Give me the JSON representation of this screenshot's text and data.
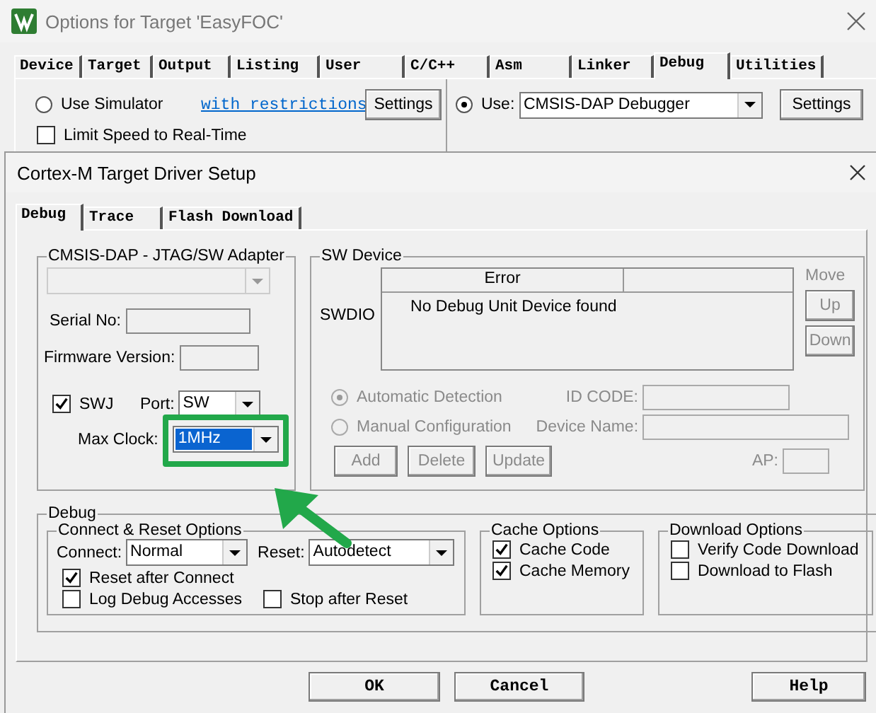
{
  "window": {
    "title": "Options for Target 'EasyFOC'"
  },
  "tabs": [
    {
      "label": "Device",
      "selected": false
    },
    {
      "label": "Target",
      "selected": false
    },
    {
      "label": "Output",
      "selected": false
    },
    {
      "label": "Listing",
      "selected": false
    },
    {
      "label": "User",
      "selected": false
    },
    {
      "label": "C/C++",
      "selected": false
    },
    {
      "label": "Asm",
      "selected": false
    },
    {
      "label": "Linker",
      "selected": false
    },
    {
      "label": "Debug",
      "selected": true
    },
    {
      "label": "Utilities",
      "selected": false
    }
  ],
  "simulator": {
    "label": "Use Simulator",
    "selected": false,
    "link": "with restrictions",
    "settings_button": "Settings",
    "limit_speed": {
      "label": "Limit Speed to Real-Time",
      "checked": false
    }
  },
  "debugger": {
    "label": "Use:",
    "selected": true,
    "value": "CMSIS-DAP Debugger",
    "settings_button": "Settings"
  },
  "dialog": {
    "title": "Cortex-M Target Driver Setup",
    "tabs": [
      {
        "label": "Debug",
        "selected": true
      },
      {
        "label": "Trace",
        "selected": false
      },
      {
        "label": "Flash Download",
        "selected": false
      }
    ],
    "adapter": {
      "title": "CMSIS-DAP - JTAG/SW Adapter",
      "serial_label": "Serial No:",
      "firmware_label": "Firmware Version:",
      "swj": {
        "label": "SWJ",
        "checked": true
      },
      "port_label": "Port:",
      "port": "SW",
      "max_clock_label": "Max Clock:",
      "max_clock": "1MHz"
    },
    "sw_device": {
      "title": "SW Device",
      "disabled": true,
      "row_label": "SWDIO",
      "column": "Error",
      "message": "No Debug Unit Device found",
      "move_label": "Move",
      "up_button": "Up",
      "down_button": "Down",
      "detection": [
        {
          "label": "Automatic Detection",
          "selected": true
        },
        {
          "label": "Manual Configuration",
          "selected": false
        }
      ],
      "id_code_label": "ID CODE:",
      "device_name_label": "Device Name:",
      "ap_label": "AP:",
      "buttons": [
        "Add",
        "Delete",
        "Update"
      ]
    },
    "debug": {
      "title": "Debug",
      "connect_reset": {
        "title": "Connect & Reset Options",
        "connect_label": "Connect:",
        "connect": "Normal",
        "reset_label": "Reset:",
        "reset": "Autodetect",
        "options": [
          {
            "label": "Reset after Connect",
            "checked": true
          },
          {
            "label": "Log Debug Accesses",
            "checked": false
          },
          {
            "label": "Stop after Reset",
            "checked": false
          }
        ]
      },
      "cache": {
        "title": "Cache Options",
        "options": [
          {
            "label": "Cache Code",
            "checked": true
          },
          {
            "label": "Cache Memory",
            "checked": true
          }
        ]
      },
      "download": {
        "title": "Download Options",
        "options": [
          {
            "label": "Verify Code Download",
            "checked": false
          },
          {
            "label": "Download to Flash",
            "checked": false
          }
        ]
      }
    },
    "buttons": [
      "OK",
      "Cancel",
      "Help"
    ]
  }
}
